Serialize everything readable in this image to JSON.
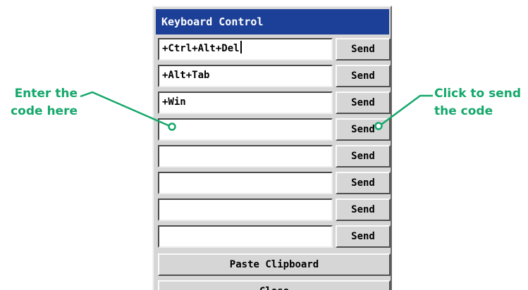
{
  "dialog": {
    "title": "Keyboard Control"
  },
  "macros": [
    {
      "value": "+Ctrl+Alt+Del",
      "send_label": "Send"
    },
    {
      "value": "+Alt+Tab",
      "send_label": "Send"
    },
    {
      "value": "+Win",
      "send_label": "Send"
    },
    {
      "value": "",
      "send_label": "Send"
    },
    {
      "value": "",
      "send_label": "Send"
    },
    {
      "value": "",
      "send_label": "Send"
    },
    {
      "value": "",
      "send_label": "Send"
    },
    {
      "value": "",
      "send_label": "Send"
    }
  ],
  "buttons": {
    "paste_clipboard": "Paste Clipboard",
    "close": "Close"
  },
  "annotations": {
    "left": {
      "line1": "Enter the",
      "line2": "code here"
    },
    "right": {
      "line1": "Click to send",
      "line2": "the code"
    },
    "color": "#14a86b"
  },
  "colors": {
    "title_bar": "#1c3f97",
    "panel": "#d6d6d6"
  }
}
